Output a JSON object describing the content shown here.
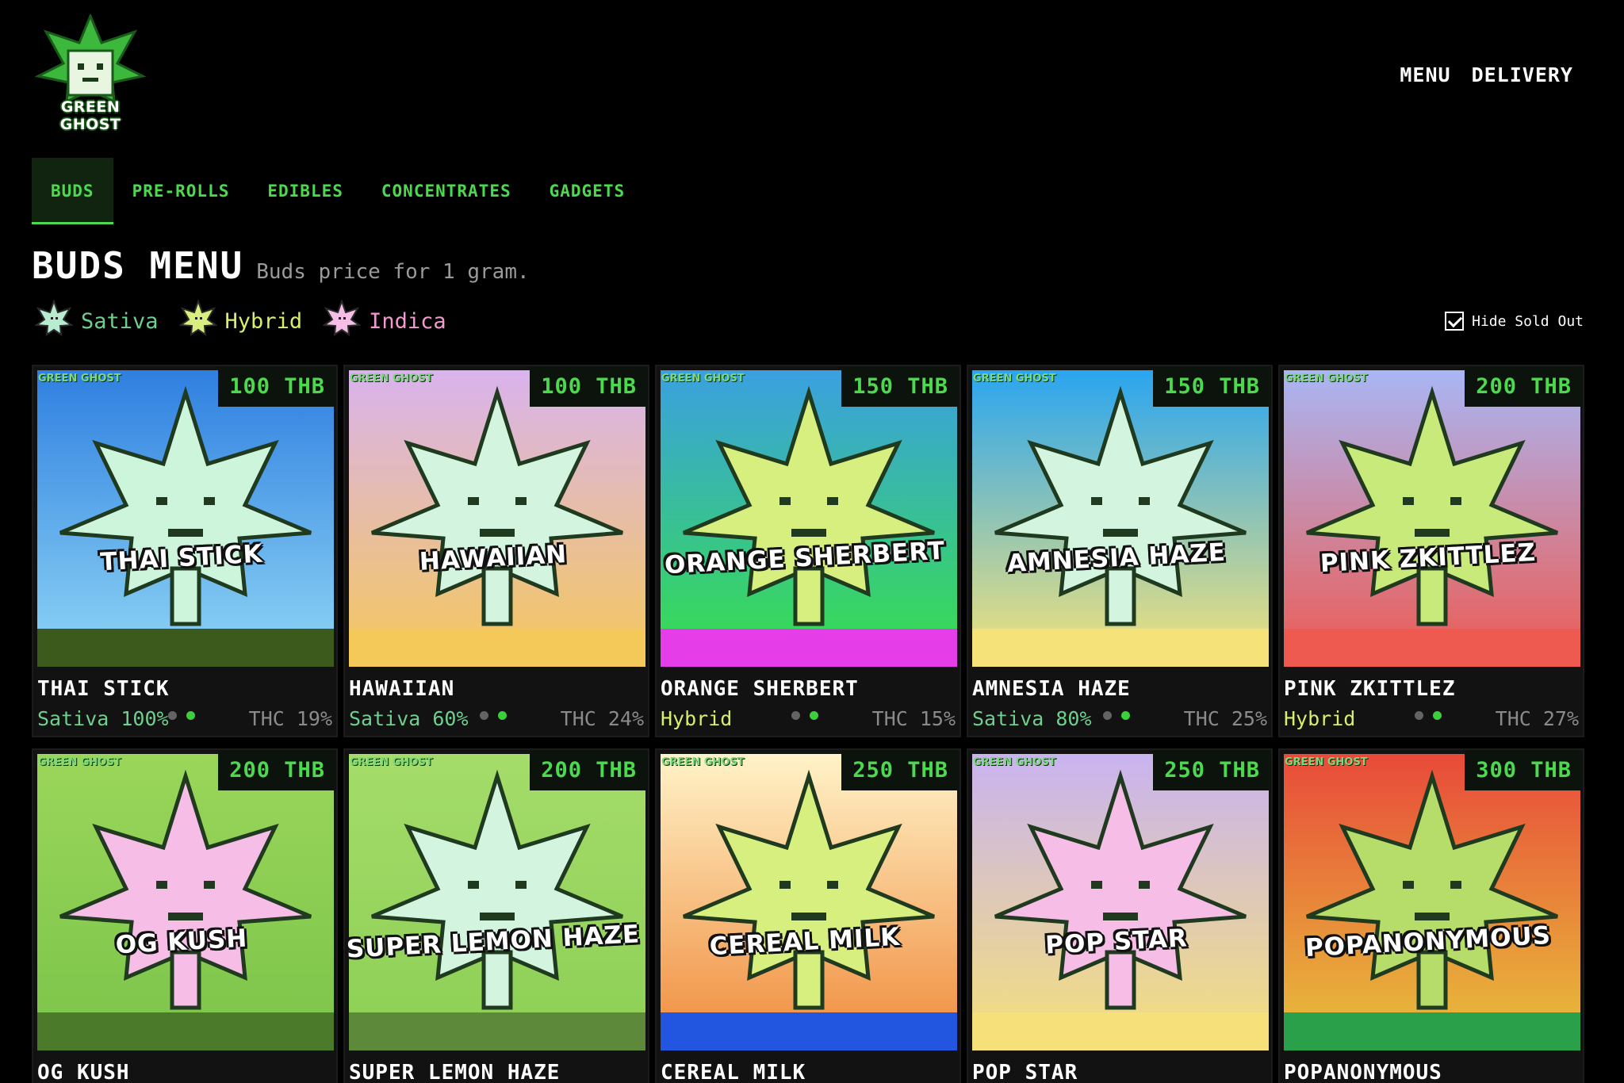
{
  "brand": {
    "logo_text": "GREEN GHOST"
  },
  "topnav": {
    "menu": "MENU",
    "delivery": "DELIVERY"
  },
  "tabs": [
    {
      "label": "BUDS",
      "active": true
    },
    {
      "label": "PRE-ROLLS",
      "active": false
    },
    {
      "label": "EDIBLES",
      "active": false
    },
    {
      "label": "CONCENTRATES",
      "active": false
    },
    {
      "label": "GADGETS",
      "active": false
    }
  ],
  "page": {
    "title": "BUDS MENU",
    "subtitle": "Buds price for 1 gram."
  },
  "legend": [
    {
      "label": "Sativa",
      "color": "#6fcf8f"
    },
    {
      "label": "Hybrid",
      "color": "#d6ef6e"
    },
    {
      "label": "Indica",
      "color": "#f29ad0"
    }
  ],
  "hide_sold_out": {
    "label": "Hide Sold Out",
    "checked": true
  },
  "products": [
    {
      "name": "THAI STICK",
      "price": "100 THB",
      "type": "Sativa 100%",
      "thc": "THC 19%",
      "type_color": "#6fcf8f",
      "leaf": "#cdf5dc",
      "bg_top": "#2f7fe0",
      "bg_bottom": "#8fd6f5",
      "ground": "#3b5a1c",
      "art_label": "THAI STICK",
      "dots": [
        false,
        true
      ]
    },
    {
      "name": "HAWAIIAN",
      "price": "100 THB",
      "type": "Sativa 60%",
      "thc": "THC 24%",
      "type_color": "#6fcf8f",
      "leaf": "#d3f5e0",
      "bg_top": "#d9b3ee",
      "bg_bottom": "#f5c85a",
      "ground": "#f5c85a",
      "art_label": "HAWAIIAN",
      "dots": [
        false,
        true
      ]
    },
    {
      "name": "ORANGE SHERBERT",
      "price": "150 THB",
      "type": "Hybrid",
      "thc": "THC 15%",
      "type_color": "#d6ef6e",
      "leaf": "#d6ef7e",
      "bg_top": "#3aa0e0",
      "bg_bottom": "#37e04a",
      "ground": "#e53ee8",
      "art_label": "ORANGE SHERBERT",
      "dots": [
        false,
        true
      ]
    },
    {
      "name": "AMNESIA HAZE",
      "price": "150 THB",
      "type": "Sativa 80%",
      "thc": "THC 25%",
      "type_color": "#6fcf8f",
      "leaf": "#d3f5e0",
      "bg_top": "#2aa5f0",
      "bg_bottom": "#f5e37a",
      "ground": "#f5e37a",
      "art_label": "AMNESIA HAZE",
      "dots": [
        false,
        true
      ]
    },
    {
      "name": "PINK ZKITTLEZ",
      "price": "200 THB",
      "type": "Hybrid",
      "thc": "THC 27%",
      "type_color": "#d6ef6e",
      "leaf": "#c8ea7a",
      "bg_top": "#a9b6f5",
      "bg_bottom": "#ee5a50",
      "ground": "#ee5a50",
      "art_label": "PINK ZKITTLEZ",
      "dots": [
        false,
        true
      ]
    },
    {
      "name": "OG KUSH",
      "price": "200 THB",
      "type": "",
      "thc": "",
      "type_color": "#f29ad0",
      "leaf": "#f6bde6",
      "bg_top": "#9ad65a",
      "bg_bottom": "#7bc44a",
      "ground": "#4a7a2a",
      "art_label": "OG KUSH",
      "dots": [
        false,
        true
      ]
    },
    {
      "name": "SUPER LEMON HAZE",
      "price": "200 THB",
      "type": "",
      "thc": "",
      "type_color": "#6fcf8f",
      "leaf": "#d3f5e0",
      "bg_top": "#a5dc6a",
      "bg_bottom": "#8ccf55",
      "ground": "#5d8a3a",
      "art_label": "SUPER LEMON HAZE",
      "dots": [
        false,
        true
      ]
    },
    {
      "name": "CEREAL MILK",
      "price": "250 THB",
      "type": "",
      "thc": "",
      "type_color": "#d6ef6e",
      "leaf": "#d6ef7e",
      "bg_top": "#fff3c8",
      "bg_bottom": "#f08a3a",
      "ground": "#2255e0",
      "art_label": "CEREAL MILK",
      "dots": [
        false,
        true
      ]
    },
    {
      "name": "POP STAR",
      "price": "250 THB",
      "type": "",
      "thc": "",
      "type_color": "#f29ad0",
      "leaf": "#f6bde6",
      "bg_top": "#c9b3f0",
      "bg_bottom": "#f5e07a",
      "ground": "#f5e07a",
      "art_label": "POP STAR",
      "dots": [
        false,
        true
      ]
    },
    {
      "name": "POPANONYMOUS",
      "price": "300 THB",
      "type": "",
      "thc": "",
      "type_color": "#d6ef6e",
      "leaf": "#b6dc6a",
      "bg_top": "#e84a3a",
      "bg_bottom": "#e8c23a",
      "ground": "#2aa04a",
      "art_label": "POPANONYMOUS",
      "dots": [
        false,
        true
      ]
    }
  ],
  "card_brand": "GREEN GHOST"
}
